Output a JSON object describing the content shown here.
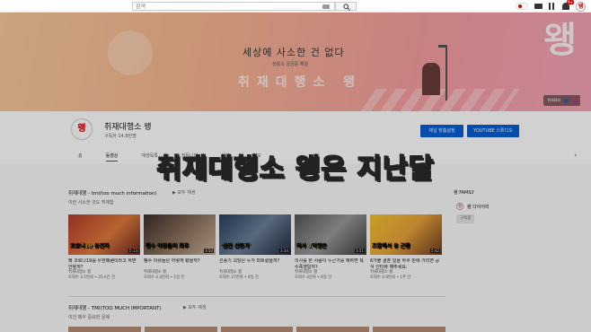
{
  "topbar": {
    "search_placeholder": "검색",
    "notification_count": "9+",
    "avatar_text": "왱"
  },
  "banner": {
    "title": "세상에 사소한 건 없다",
    "subtitle": "생활속 궁금증 해결",
    "script_text": "취재대행소 왱",
    "big_logo": "왱",
    "links_label": "취재의뢰"
  },
  "channel": {
    "avatar_text": "왱",
    "name": "취재대행소 왱",
    "subscribers": "구독자 14.8만명",
    "customize_button": "채널 맞춤설정",
    "studio_button": "YOUTUBE 스튜디오",
    "tabs": [
      "홈",
      "동영상",
      "재생목록",
      "커뮤니티",
      "채널",
      "정보"
    ],
    "more_arrow": "›"
  },
  "subtitle_overlay": "취재대행소 왱은 지난달",
  "section1": {
    "title": "취재대행 - tmi(too much information)",
    "play_all": "▶ 모두 재생",
    "desc": "이런 사소한 것도 취재함",
    "videos": [
      {
        "caption": "코로나19 유전자",
        "duration": "5:13",
        "title": "왜 코로나19를 우한페렴이라고 하면 안될까?",
        "channel": "취재대행소 왱",
        "stats": "조회수 3.1만회 • 21시간 전"
      },
      {
        "caption": "펭수 아류들의 최후",
        "duration": "3:50",
        "title": "펭수 아류들은 어떻게 됐을까?",
        "channel": "취재대행소 왱",
        "stats": "조회수 4.3만회 • 1일 전"
      },
      {
        "caption": "'삼진 선풍기'",
        "duration": "3:34",
        "title": "선풍기 괴담은 누가 퍼트렸을까?",
        "channel": "취재대행소 왱",
        "stats": "조회수 27만회 • 4일 전"
      },
      {
        "caption": "의사 1억명은",
        "duration": "3:51",
        "title": "의사를 한 사람이 누군가를 해하면 특수폭행일까?",
        "channel": "취재대행소 왱",
        "stats": "조회수 4만회 • 6일 전"
      },
      {
        "caption": "조합해서 유 근황",
        "duration": "5:42",
        "title": "6가볼 결혼 일을 하루 만에 거리면 공식 인터뷰 해주세요.",
        "channel": "취재대행소 왱",
        "stats": "조회수 4.6만회 • 1주 전"
      }
    ]
  },
  "section2": {
    "title": "취재대행 - TMI(TOO MUCH IMPORTANT)",
    "play_all": "▶ 모두 재생",
    "desc": "이건 매우 중요한 문제"
  },
  "sidebar": {
    "title": "왱 FAMILY",
    "item_avatar": "왱",
    "item_name": "왱 다이어리",
    "subscribe_label": "구독중"
  },
  "colors": {
    "accent_blue": "#065fd4",
    "badge_red": "#cc0000"
  }
}
